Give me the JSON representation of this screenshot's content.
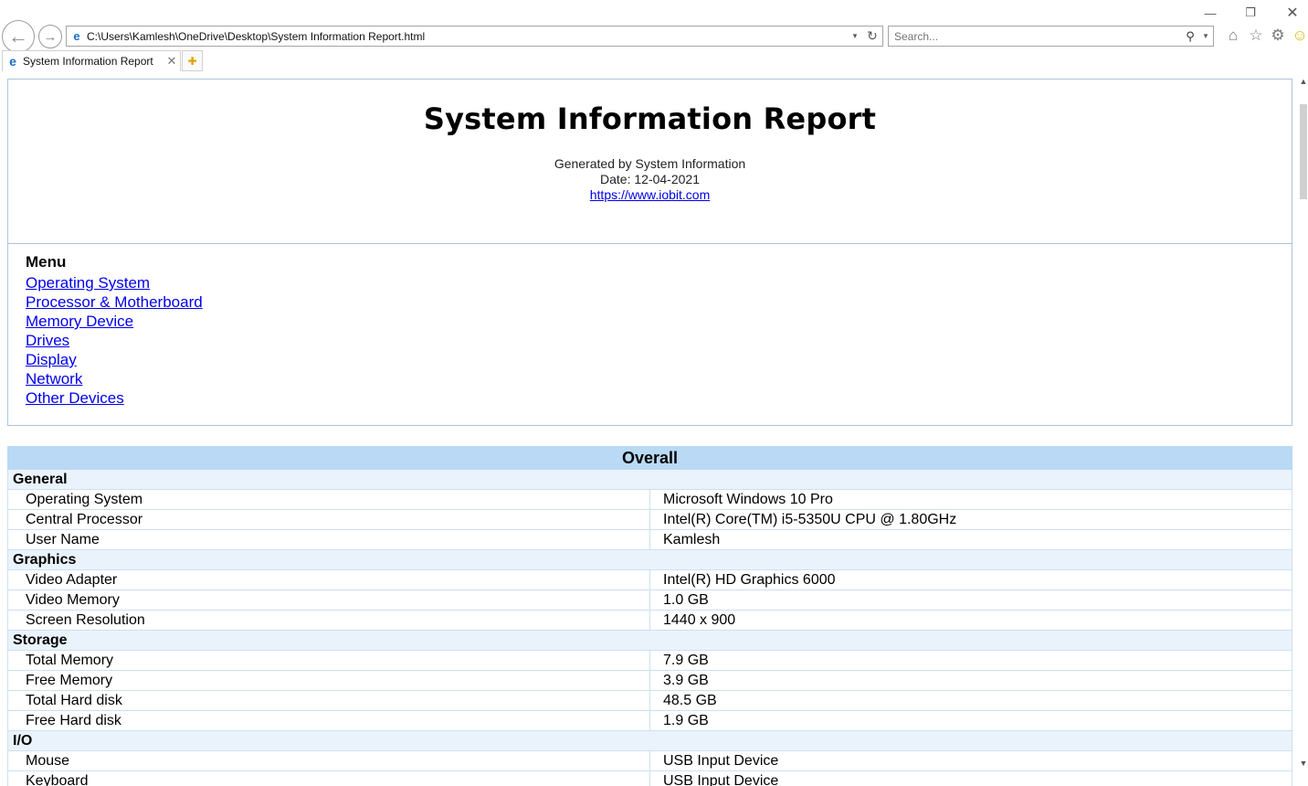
{
  "browser": {
    "window_controls": {
      "minimize": "—",
      "restore": "❐",
      "close": "✕"
    },
    "back_glyph": "←",
    "forward_glyph": "→",
    "address": "C:\\Users\\Kamlesh\\OneDrive\\Desktop\\System Information Report.html",
    "search_placeholder": "Search...",
    "tab_title": "System Information Report",
    "icons": {
      "ie": "e",
      "dropdown": "▾",
      "refresh": "↻",
      "search": "⚲",
      "home": "⌂",
      "favorites": "☆",
      "settings": "⚙",
      "feedback": "☺",
      "close": "✕",
      "new_tab": "✚",
      "scroll_up": "▲",
      "scroll_down": "▼"
    }
  },
  "report": {
    "title": "System Information Report",
    "generated_by": "Generated by System Information",
    "date_line": "Date: 12-04-2021",
    "link": "https://www.iobit.com"
  },
  "menu": {
    "title": "Menu",
    "items": [
      "Operating System",
      "Processor & Motherboard",
      "Memory Device",
      "Drives",
      "Display",
      "Network",
      "Other Devices"
    ]
  },
  "overall": {
    "title": "Overall",
    "groups": [
      {
        "name": "General",
        "rows": [
          {
            "label": "Operating System",
            "value": "Microsoft Windows 10 Pro"
          },
          {
            "label": "Central Processor",
            "value": "Intel(R) Core(TM) i5-5350U CPU @ 1.80GHz"
          },
          {
            "label": "User Name",
            "value": "Kamlesh"
          }
        ]
      },
      {
        "name": "Graphics",
        "rows": [
          {
            "label": "Video Adapter",
            "value": "Intel(R) HD Graphics 6000"
          },
          {
            "label": "Video Memory",
            "value": "1.0 GB"
          },
          {
            "label": "Screen Resolution",
            "value": "1440 x 900"
          }
        ]
      },
      {
        "name": "Storage",
        "rows": [
          {
            "label": "Total Memory",
            "value": "7.9 GB"
          },
          {
            "label": "Free Memory",
            "value": "3.9 GB"
          },
          {
            "label": "Total Hard disk",
            "value": "48.5 GB"
          },
          {
            "label": "Free Hard disk",
            "value": "1.9 GB"
          }
        ]
      },
      {
        "name": "I/O",
        "rows": [
          {
            "label": "Mouse",
            "value": "USB Input Device"
          },
          {
            "label": "Keyboard",
            "value": "USB Input Device"
          }
        ]
      }
    ]
  }
}
